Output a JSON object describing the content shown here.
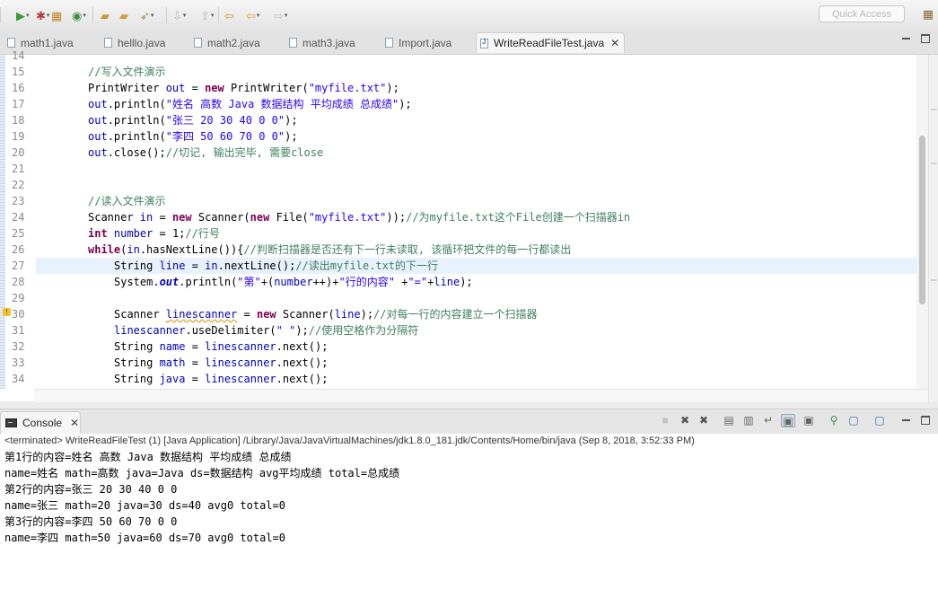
{
  "toolbar": {
    "quick_access_placeholder": "Quick Access",
    "buttons": [
      {
        "name": "run-icon",
        "glyph": "▶",
        "color": "#3a9a3a"
      },
      {
        "name": "debug-icon",
        "glyph": "✱",
        "color": "#b33b3b"
      },
      {
        "name": "new-package-icon",
        "glyph": "▦",
        "color": "#c58b2a"
      },
      {
        "name": "new-class-icon",
        "glyph": "◉",
        "color": "#3f8f3f"
      },
      {
        "name": "open-type-icon",
        "glyph": "▰",
        "color": "#c99a2e"
      },
      {
        "name": "open-folder-icon",
        "glyph": "▰",
        "color": "#d49c3a"
      },
      {
        "name": "open-task-icon",
        "glyph": "➶",
        "color": "#a58a4a"
      },
      {
        "name": "next-annotation-icon",
        "glyph": "⇩",
        "color": "#b8b8b8"
      },
      {
        "name": "prev-annotation-icon",
        "glyph": "⇧",
        "color": "#b8b8b8"
      },
      {
        "name": "last-edit-icon",
        "glyph": "⇦",
        "color": "#d39b2c"
      },
      {
        "name": "back-icon",
        "glyph": "⇦",
        "color": "#e0a830"
      },
      {
        "name": "forward-icon",
        "glyph": "⇨",
        "color": "#c4c4c4"
      }
    ]
  },
  "editor_tabs": [
    {
      "label": "math1.java",
      "active": false
    },
    {
      "label": "helllo.java",
      "active": false
    },
    {
      "label": "math2.java",
      "active": false
    },
    {
      "label": "math3.java",
      "active": false
    },
    {
      "label": "Import.java",
      "active": false
    },
    {
      "label": "WriteReadFileTest.java",
      "active": true
    }
  ],
  "editor": {
    "current_line": 27,
    "warning_line": 30,
    "lines": [
      {
        "n": "14",
        "indent": 0,
        "tokens": []
      },
      {
        "n": "15",
        "indent": 0,
        "tokens": [
          {
            "t": "c",
            "v": "//写入文件演示"
          }
        ]
      },
      {
        "n": "16",
        "indent": 0,
        "tokens": [
          {
            "t": "p",
            "v": "PrintWriter "
          },
          {
            "t": "f",
            "v": "out"
          },
          {
            "t": "p",
            "v": " = "
          },
          {
            "t": "k",
            "v": "new"
          },
          {
            "t": "p",
            "v": " PrintWriter("
          },
          {
            "t": "s",
            "v": "\"myfile.txt\""
          },
          {
            "t": "p",
            "v": ");"
          }
        ]
      },
      {
        "n": "17",
        "indent": 0,
        "tokens": [
          {
            "t": "f",
            "v": "out"
          },
          {
            "t": "p",
            "v": ".println("
          },
          {
            "t": "s",
            "v": "\"姓名 高数 Java 数据结构 平均成绩 总成绩\""
          },
          {
            "t": "p",
            "v": ");"
          }
        ]
      },
      {
        "n": "18",
        "indent": 0,
        "tokens": [
          {
            "t": "f",
            "v": "out"
          },
          {
            "t": "p",
            "v": ".println("
          },
          {
            "t": "s",
            "v": "\"张三 20 30 40 0 0\""
          },
          {
            "t": "p",
            "v": ");"
          }
        ]
      },
      {
        "n": "19",
        "indent": 0,
        "tokens": [
          {
            "t": "f",
            "v": "out"
          },
          {
            "t": "p",
            "v": ".println("
          },
          {
            "t": "s",
            "v": "\"李四 50 60 70 0 0\""
          },
          {
            "t": "p",
            "v": ");"
          }
        ]
      },
      {
        "n": "20",
        "indent": 0,
        "tokens": [
          {
            "t": "f",
            "v": "out"
          },
          {
            "t": "p",
            "v": ".close();"
          },
          {
            "t": "c",
            "v": "//切记, 输出完毕, 需要close"
          }
        ]
      },
      {
        "n": "21",
        "indent": 0,
        "tokens": []
      },
      {
        "n": "22",
        "indent": 0,
        "tokens": []
      },
      {
        "n": "23",
        "indent": 0,
        "tokens": [
          {
            "t": "c",
            "v": "//读入文件演示"
          }
        ]
      },
      {
        "n": "24",
        "indent": 0,
        "tokens": [
          {
            "t": "p",
            "v": "Scanner "
          },
          {
            "t": "f",
            "v": "in"
          },
          {
            "t": "p",
            "v": " = "
          },
          {
            "t": "k",
            "v": "new"
          },
          {
            "t": "p",
            "v": " Scanner("
          },
          {
            "t": "k",
            "v": "new"
          },
          {
            "t": "p",
            "v": " File("
          },
          {
            "t": "s",
            "v": "\"myfile.txt\""
          },
          {
            "t": "p",
            "v": "));"
          },
          {
            "t": "c",
            "v": "//为myfile.txt这个File创建一个扫描器in"
          }
        ]
      },
      {
        "n": "25",
        "indent": 0,
        "tokens": [
          {
            "t": "k",
            "v": "int"
          },
          {
            "t": "p",
            "v": " "
          },
          {
            "t": "f",
            "v": "number"
          },
          {
            "t": "p",
            "v": " = 1;"
          },
          {
            "t": "c",
            "v": "//行号"
          }
        ]
      },
      {
        "n": "26",
        "indent": 0,
        "tokens": [
          {
            "t": "k",
            "v": "while"
          },
          {
            "t": "p",
            "v": "("
          },
          {
            "t": "f",
            "v": "in"
          },
          {
            "t": "p",
            "v": ".hasNextLine()){"
          },
          {
            "t": "c",
            "v": "//判断扫描器是否还有下一行未读取, 该循环把文件的每一行都读出"
          }
        ]
      },
      {
        "n": "27",
        "indent": 1,
        "tokens": [
          {
            "t": "p",
            "v": "String "
          },
          {
            "t": "f",
            "v": "line"
          },
          {
            "t": "p",
            "v": " = "
          },
          {
            "t": "f",
            "v": "in"
          },
          {
            "t": "p",
            "v": ".nextLine();"
          },
          {
            "t": "c",
            "v": "//读出myfile.txt的下一行"
          }
        ]
      },
      {
        "n": "28",
        "indent": 1,
        "tokens": [
          {
            "t": "p",
            "v": "System."
          },
          {
            "t": "fi",
            "v": "out"
          },
          {
            "t": "p",
            "v": ".println("
          },
          {
            "t": "s",
            "v": "\"第\""
          },
          {
            "t": "p",
            "v": "+("
          },
          {
            "t": "f",
            "v": "number"
          },
          {
            "t": "p",
            "v": "++)+"
          },
          {
            "t": "s",
            "v": "\"行的内容\""
          },
          {
            "t": "p",
            "v": " +"
          },
          {
            "t": "s",
            "v": "\"=\""
          },
          {
            "t": "p",
            "v": "+"
          },
          {
            "t": "f",
            "v": "line"
          },
          {
            "t": "p",
            "v": ");"
          }
        ]
      },
      {
        "n": "29",
        "indent": 0,
        "tokens": []
      },
      {
        "n": "30",
        "indent": 1,
        "tokens": [
          {
            "t": "p",
            "v": "Scanner "
          },
          {
            "t": "w",
            "v": "linescanner"
          },
          {
            "t": "p",
            "v": " = "
          },
          {
            "t": "k",
            "v": "new"
          },
          {
            "t": "p",
            "v": " Scanner("
          },
          {
            "t": "f",
            "v": "line"
          },
          {
            "t": "p",
            "v": ");"
          },
          {
            "t": "c",
            "v": "//对每一行的内容建立一个扫描器"
          }
        ]
      },
      {
        "n": "31",
        "indent": 1,
        "tokens": [
          {
            "t": "f",
            "v": "linescanner"
          },
          {
            "t": "p",
            "v": ".useDelimiter("
          },
          {
            "t": "s",
            "v": "\" \""
          },
          {
            "t": "p",
            "v": ");"
          },
          {
            "t": "c",
            "v": "//使用空格作为分隔符"
          }
        ]
      },
      {
        "n": "32",
        "indent": 1,
        "tokens": [
          {
            "t": "p",
            "v": "String "
          },
          {
            "t": "f",
            "v": "name"
          },
          {
            "t": "p",
            "v": " = "
          },
          {
            "t": "f",
            "v": "linescanner"
          },
          {
            "t": "p",
            "v": ".next();"
          }
        ]
      },
      {
        "n": "33",
        "indent": 1,
        "tokens": [
          {
            "t": "p",
            "v": "String "
          },
          {
            "t": "f",
            "v": "math"
          },
          {
            "t": "p",
            "v": " = "
          },
          {
            "t": "f",
            "v": "linescanner"
          },
          {
            "t": "p",
            "v": ".next();"
          }
        ]
      },
      {
        "n": "34",
        "indent": 1,
        "tokens": [
          {
            "t": "p",
            "v": "String "
          },
          {
            "t": "f",
            "v": "java"
          },
          {
            "t": "p",
            "v": " = "
          },
          {
            "t": "f",
            "v": "linescanner"
          },
          {
            "t": "p",
            "v": ".next();"
          }
        ]
      }
    ]
  },
  "console": {
    "tab_label": "Console",
    "status": "<terminated> WriteReadFileTest (1) [Java Application] /Library/Java/JavaVirtualMachines/jdk1.8.0_181.jdk/Contents/Home/bin/java (Sep 8, 2018, 3:52:33 PM)",
    "output": [
      "第1行的内容=姓名 高数 Java 数据结构 平均成绩 总成绩",
      "name=姓名 math=高数 java=Java ds=数据结构 avg平均成绩 total=总成绩",
      "第2行的内容=张三 20 30 40 0 0",
      "name=张三 math=20 java=30 ds=40 avg0 total=0",
      "第3行的内容=李四 50 60 70 0 0",
      "name=李四 math=50 java=60 ds=70 avg0 total=0"
    ],
    "buttons": [
      {
        "name": "terminate-icon",
        "glyph": "■"
      },
      {
        "name": "remove-launch-icon",
        "glyph": "✖"
      },
      {
        "name": "remove-all-terminated-icon",
        "glyph": "✖"
      },
      {
        "name": "clear-console-icon",
        "glyph": "▤"
      },
      {
        "name": "scroll-lock-icon",
        "glyph": "▥"
      },
      {
        "name": "word-wrap-icon",
        "glyph": "↵"
      },
      {
        "name": "show-on-stdout-icon",
        "glyph": "▣"
      },
      {
        "name": "show-on-stderr-icon",
        "glyph": "▣"
      },
      {
        "name": "pin-console-icon",
        "glyph": "⚲"
      },
      {
        "name": "display-console-icon",
        "glyph": "▢"
      },
      {
        "name": "open-console-icon",
        "glyph": "▢"
      }
    ]
  }
}
